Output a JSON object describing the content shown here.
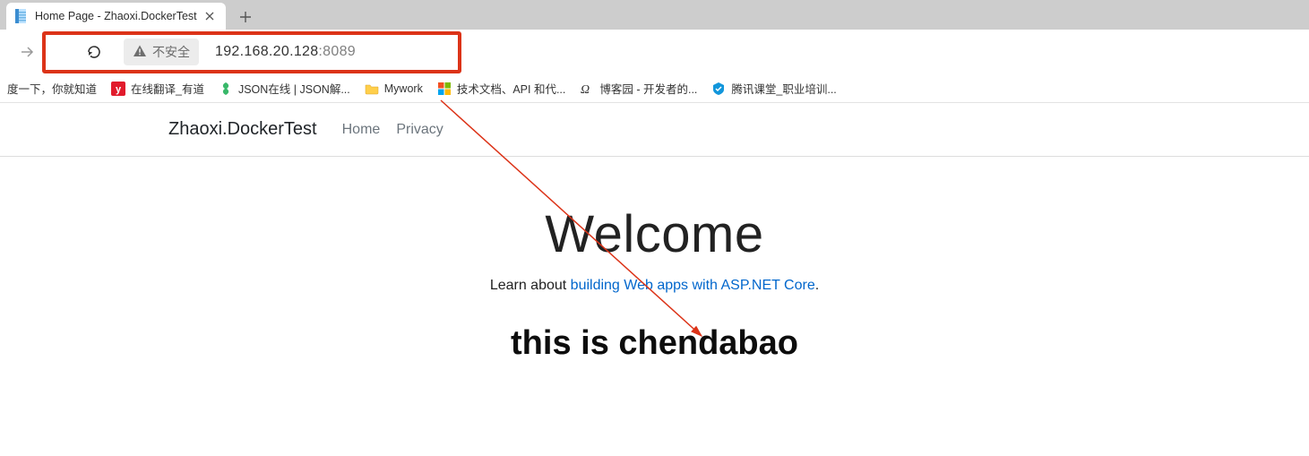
{
  "tab": {
    "title": "Home Page - Zhaoxi.DockerTest"
  },
  "address": {
    "security_label": "不安全",
    "url_host": "192.168.20.128",
    "url_port": ":8089"
  },
  "bookmarks": [
    {
      "label": "度一下，你就知道"
    },
    {
      "label": "在线翻译_有道"
    },
    {
      "label": "JSON在线 | JSON解..."
    },
    {
      "label": "Mywork"
    },
    {
      "label": "技术文档、API 和代..."
    },
    {
      "label": "博客园 - 开发者的..."
    },
    {
      "label": "腾讯课堂_职业培训..."
    }
  ],
  "nav": {
    "brand": "Zhaoxi.DockerTest",
    "home": "Home",
    "privacy": "Privacy"
  },
  "page": {
    "welcome": "Welcome",
    "learn_prefix": "Learn about ",
    "learn_link": "building Web apps with ASP.NET Core",
    "learn_suffix": ".",
    "hero": "this is chendabao"
  }
}
